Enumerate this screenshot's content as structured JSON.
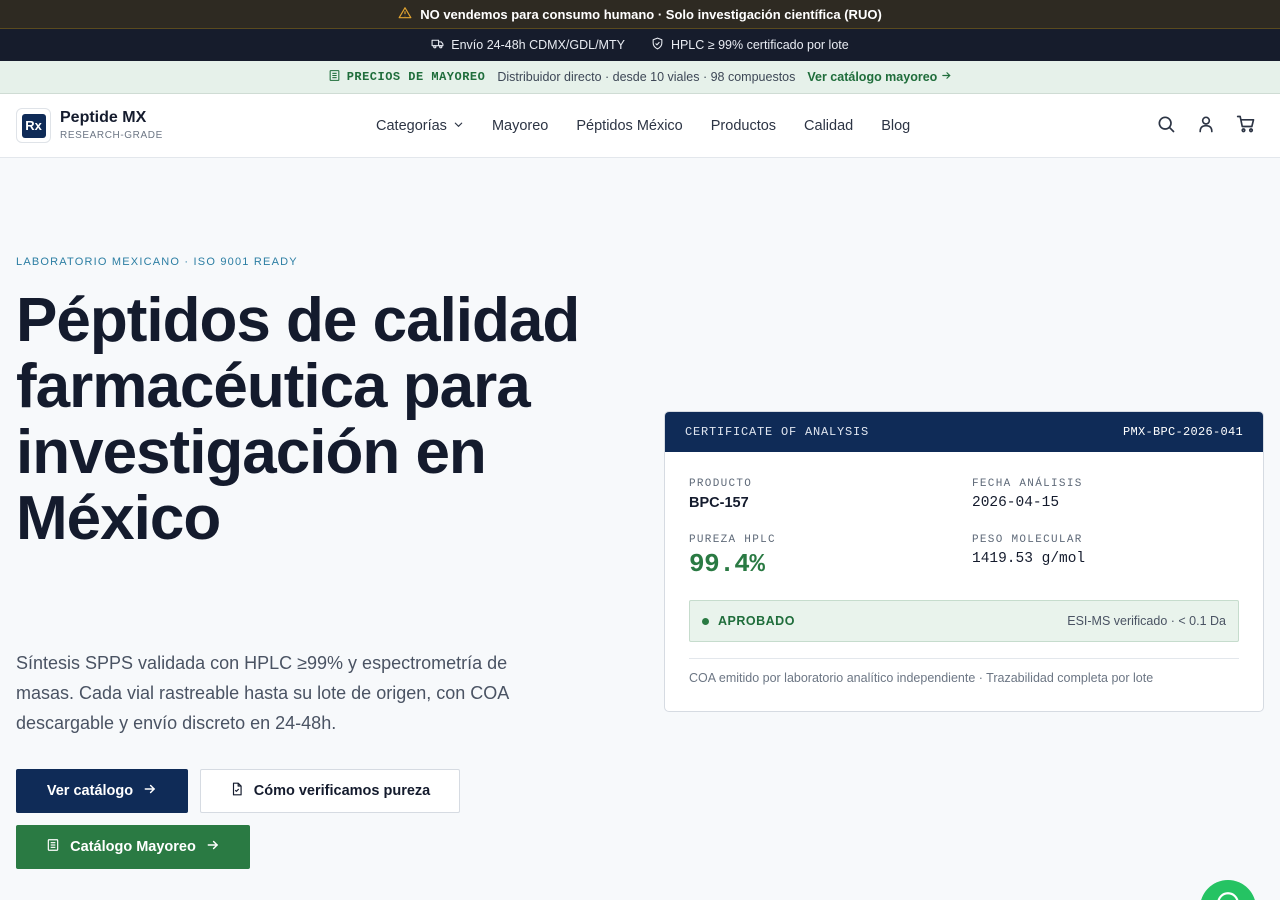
{
  "banner": {
    "warning_text": "NO vendemos para consumo humano · Solo investigación científica (RUO)",
    "shipping_text": "Envío 24-48h CDMX/GDL/MTY",
    "hplc_text": "HPLC ≥ 99% certificado por lote"
  },
  "wholesale_bar": {
    "tag": "PRECIOS DE MAYOREO",
    "description": "Distribuidor directo · desde 10 viales · 98 compuestos",
    "link": "Ver catálogo mayoreo"
  },
  "nav": {
    "brand_name": "Peptide MX",
    "brand_tagline": "RESEARCH-GRADE",
    "logo_mark": "Rx",
    "items": [
      "Categorías",
      "Mayoreo",
      "Péptidos México",
      "Productos",
      "Calidad",
      "Blog"
    ]
  },
  "hero": {
    "eyebrow": "LABORATORIO MEXICANO · ISO 9001 READY",
    "headline": "Péptidos de calidad farmacéutica para investigación en México",
    "lead": "Síntesis SPPS validada con HPLC ≥99% y espectrometría de masas. Cada vial rastreable hasta su lote de origen, con COA descargable y envío discreto en 24-48h.",
    "primary_cta": "Ver catálogo",
    "secondary_cta": "Cómo verificamos pureza",
    "wholesale_cta": "Catálogo Mayoreo"
  },
  "coa": {
    "title": "CERTIFICATE OF ANALYSIS",
    "certificate_id": "PMX-BPC-2026-041",
    "product_label": "PRODUCTO",
    "product_value": "BPC-157",
    "date_label": "FECHA ANÁLISIS",
    "date_value": "2026-04-15",
    "purity_label": "PUREZA HPLC",
    "purity_value": "99.4%",
    "weight_label": "PESO MOLECULAR",
    "weight_value": "1419.53 g/mol",
    "status_label": "APROBADO",
    "status_detail": "ESI-MS verificado · < 0.1 Da",
    "footer": "COA emitido por laboratorio analítico independiente · Trazabilidad completa por lote"
  },
  "colors": {
    "navy": "#0f2b57",
    "green": "#2a7a43",
    "accent_teal": "#2c7ea3",
    "whatsapp": "#25c363"
  }
}
